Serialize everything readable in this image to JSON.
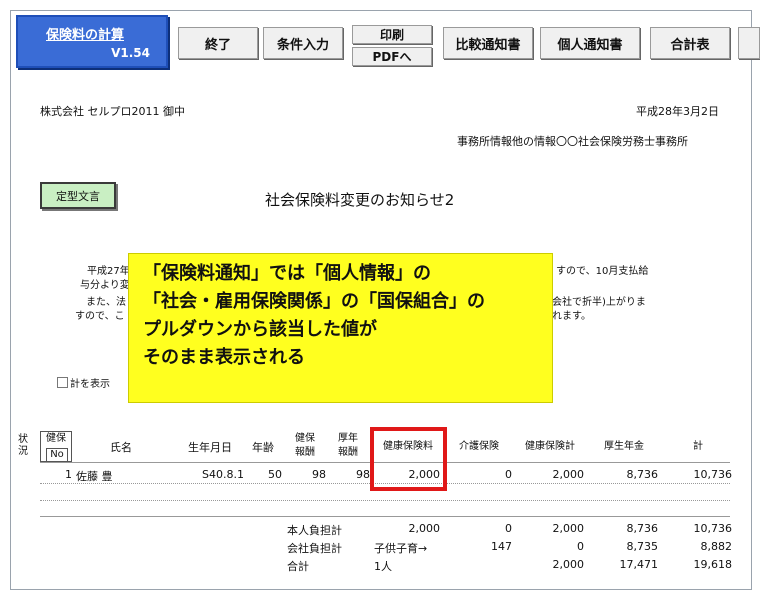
{
  "toolbar": {
    "logo_title": "保険料の計算",
    "logo_version": "V1.54",
    "end": "終了",
    "conditions": "条件入力",
    "print": "印刷",
    "pdf": "PDFへ",
    "compare": "比較通知書",
    "personal": "個人通知書",
    "total": "合計表"
  },
  "doc": {
    "recipient": "株式会社 セルプロ2011 御中",
    "date": "平成28年3月2日",
    "office": "事務所情報他の情報〇〇社会保険労務士事務所",
    "stamp": "定型文言",
    "title": "社会保険料変更のお知らせ2",
    "body_l1": "平成27年",
    "body_l2": "与分より変",
    "body_l3": "また、法",
    "body_l4": "すので、こ",
    "body_r1": "すので、10月支払給",
    "body_r2": "会社で折半)上がりま",
    "body_r3": "れます。",
    "checkbox_label": "計を表示"
  },
  "callout": {
    "line1": "「保険料通知」では「個人情報」の",
    "line2": "「社会・雇用保険関係」の「国保組合」の",
    "line3": "プルダウンから該当した値が",
    "line4": "そのまま表示される"
  },
  "table": {
    "h_status": "状況",
    "h_no_1": "健保",
    "h_no_2": "No",
    "h_name": "氏名",
    "h_birth": "生年月日",
    "h_age": "年齢",
    "h_kenpo_1": "健保",
    "h_kenpo_2": "報酬",
    "h_kosei_1": "厚年",
    "h_kosei_2": "報酬",
    "h_health": "健康保険料",
    "h_care": "介護保険",
    "h_health_total": "健康保険計",
    "h_pension": "厚生年金",
    "h_sum": "計",
    "row": {
      "no": "1",
      "name": "佐藤 豊",
      "birth": "S40.8.1",
      "age": "50",
      "kenpo": "98",
      "kosei": "98",
      "health": "2,000",
      "care": "0",
      "health_total": "2,000",
      "pension": "8,736",
      "sum": "10,736"
    },
    "summary": [
      {
        "label": "本人負担計",
        "health": "2,000",
        "care": "0",
        "health_total": "2,000",
        "pension": "8,736",
        "sum": "10,736"
      },
      {
        "label": "会社負担計",
        "health": "子供子育→",
        "care": "147",
        "health_total": "0",
        "pension": "8,735",
        "sum": "8,882"
      },
      {
        "label": "合計",
        "health": "1人",
        "care": "",
        "health_total": "2,000",
        "pension": "17,471",
        "sum": "19,618"
      }
    ]
  },
  "colors": {
    "logo": "#3a6cd6",
    "stamp": "#c9efc3",
    "callout": "#ffff1f",
    "highlight": "#e01818"
  }
}
